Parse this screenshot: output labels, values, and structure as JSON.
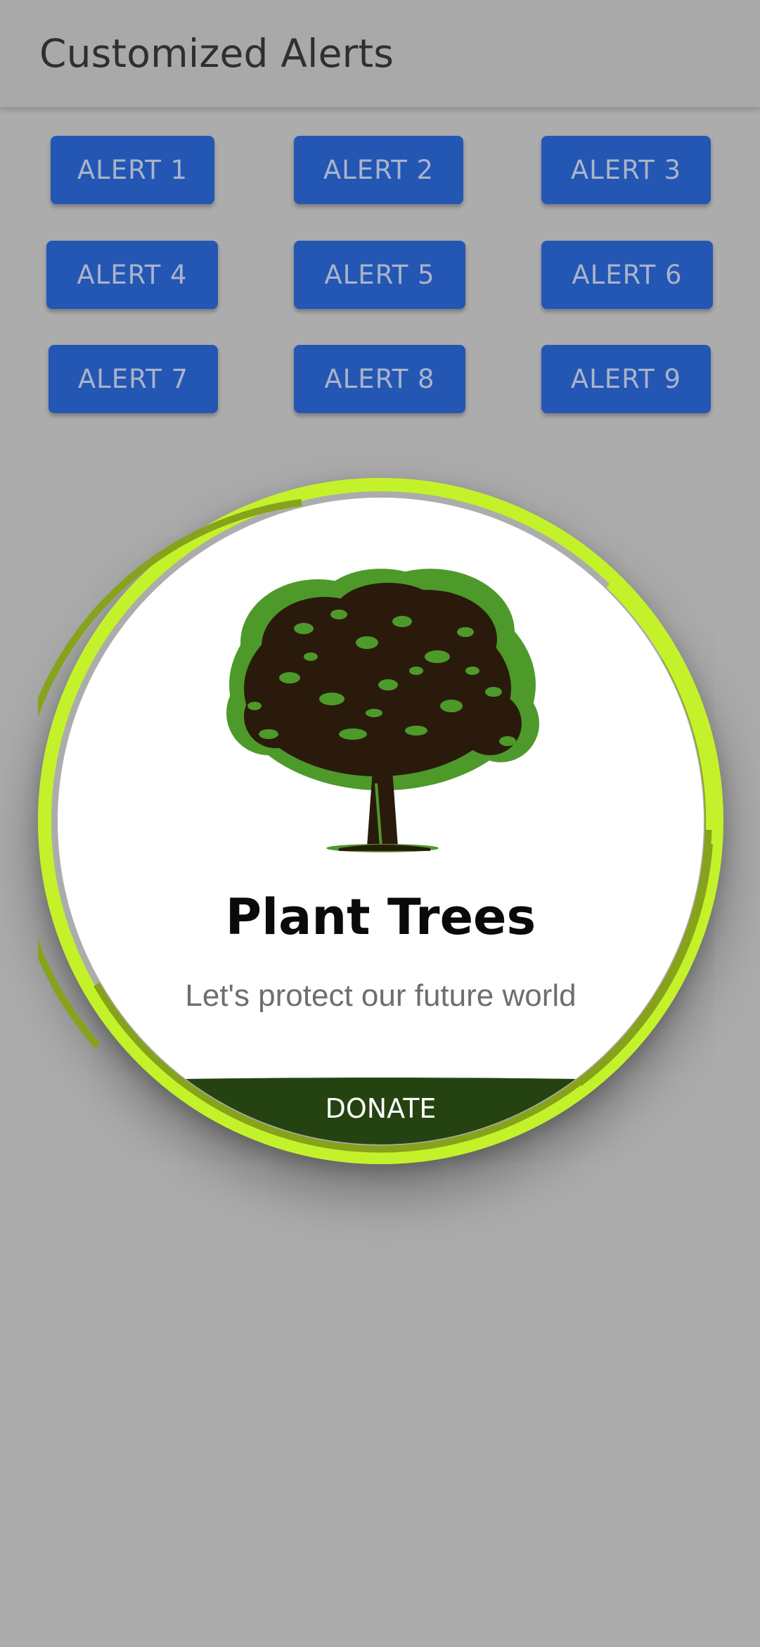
{
  "appbar": {
    "title": "Customized Alerts"
  },
  "alerts": [
    "ALERT 1",
    "ALERT 2",
    "ALERT 3",
    "ALERT 4",
    "ALERT 5",
    "ALERT 6",
    "ALERT 7",
    "ALERT 8",
    "ALERT 9"
  ],
  "dialog": {
    "title": "Plant Trees",
    "subtitle": "Let's protect our future world",
    "action_label": "DONATE",
    "image_icon": "tree-icon"
  },
  "colors": {
    "background": "#acacac",
    "button": "#2456b4",
    "button_text": "#a9b4c8",
    "ring_light": "#c4f22a",
    "ring_dark": "#86a31b",
    "action_bar": "#244310",
    "tree_leaf": "#4d9a2a",
    "tree_trunk": "#2a1a0c"
  }
}
